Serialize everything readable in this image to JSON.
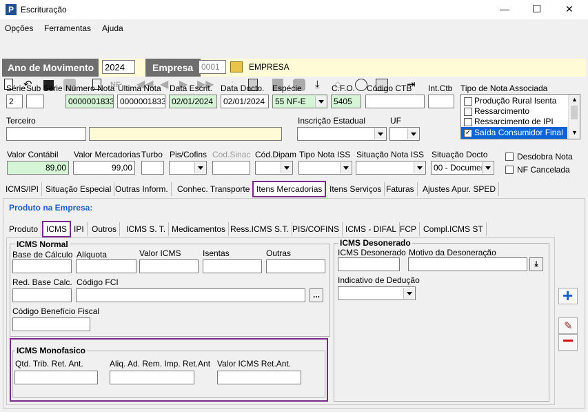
{
  "window": {
    "title": "Escrituração",
    "minimize": "—",
    "maximize": "☐",
    "close": "✕"
  },
  "menu": [
    "Opções",
    "Ferramentas",
    "Ajuda"
  ],
  "header": {
    "ano_label": "Ano de Movimento",
    "ano_value": "2024",
    "empresa_label": "Empresa",
    "empresa_code": "0001",
    "empresa_name": "EMPRESA"
  },
  "form": {
    "serie_label": "Série",
    "serie_value": "2",
    "subserie_label": "Sub Série",
    "subserie_value": "",
    "numero_label": "Número Nota",
    "numero_value": "0000001833",
    "ultima_label": "Última Nota",
    "ultima_value": "0000001833",
    "data_escrit_label": "Data Escrit.",
    "data_escrit_value": "02/01/2024",
    "data_docto_label": "Data Docto.",
    "data_docto_value": "02/01/2024",
    "especie_label": "Espécie",
    "especie_value": "55   NF-E",
    "cfo_label": "C.F.O.",
    "cfo_value": "5405",
    "codigo_ctb_label": "Código CTB",
    "int_ctb_label": "Int.Ctb",
    "tipo_nota_label": "Tipo de Nota Associada",
    "tipo_nota_items": [
      {
        "label": "Produção Rural Isenta",
        "checked": false
      },
      {
        "label": "Ressarcimento",
        "checked": false
      },
      {
        "label": "Ressarcimento de IPI",
        "checked": false
      },
      {
        "label": "Saída Consumidor Final",
        "checked": true
      }
    ],
    "terceiro_label": "Terceiro",
    "inscricao_label": "Inscrição Estadual",
    "uf_label": "UF",
    "valor_contabil_label": "Valor Contábil",
    "valor_contabil_value": "89,00",
    "valor_merc_label": "Valor Mercadorias",
    "valor_merc_value": "99,00",
    "turbo_label": "Turbo",
    "pis_label": "Pis/Cofins",
    "cod_sinac_label": "Cod.Sinac",
    "cod_dipam_label": "Cód.Dipam",
    "tipo_iss_label": "Tipo Nota ISS",
    "sit_iss_label": "Situação Nota ISS",
    "sit_docto_label": "Situação Docto",
    "sit_docto_value": "00 - Documen",
    "desdobra_label": "Desdobra Nota",
    "nf_cancelada_label": "NF Cancelada"
  },
  "main_tabs": [
    "ICMS/IPI",
    "Situação Especial",
    "Outras Inform.",
    "Conhec. Transporte",
    "Itens Mercadorias",
    "Itens Serviços",
    "Faturas",
    "Ajustes Apur. SPED"
  ],
  "produto_heading": "Produto na Empresa:",
  "sub_tabs": [
    "Produto",
    "ICMS",
    "IPI",
    "Outros",
    "ICMS S. T.",
    "Medicamentos",
    "Ress.ICMS S.T.",
    "PIS/COFINS",
    "ICMS - DIFAL",
    "FCP",
    "Compl.ICMS ST"
  ],
  "icms_normal": {
    "title": "ICMS Normal",
    "base_label": "Base de Cálculo",
    "aliquota_label": "Alíquota",
    "valor_label": "Valor ICMS",
    "isentas_label": "Isentas",
    "outras_label": "Outras",
    "red_base_label": "Red. Base Calc.",
    "codigo_fci_label": "Código FCI",
    "ellipsis": "...",
    "beneficio_label": "Código Benefício Fiscal"
  },
  "icms_desonerado": {
    "title": "ICMS Desonerado",
    "valor_label": "ICMS Desonerado",
    "motivo_label": "Motivo da Desoneração",
    "indicativo_label": "Indicativo de Dedução"
  },
  "icms_monofasico": {
    "title": "ICMS Monofasico",
    "qtd_label": "Qtd. Trib. Ret. Ant.",
    "aliq_label": "Aliq. Ad. Rem. Imp. Ret.Ant",
    "valor_label": "Valor ICMS Ret.Ant."
  },
  "side_buttons": {
    "add": "+",
    "remove": "−"
  },
  "colors": {
    "header_bg": "#6e6e6e",
    "highlight": "#7a2a8a",
    "accent_blue": "#1a5fc8",
    "remove_red": "#d01010"
  }
}
